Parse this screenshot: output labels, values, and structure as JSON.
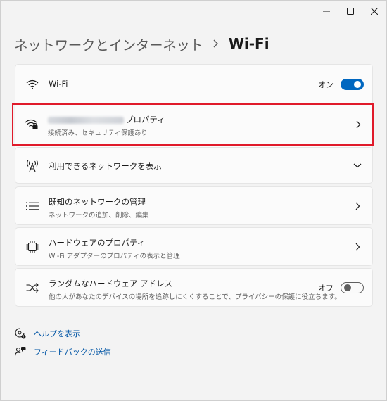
{
  "window": {
    "controls": [
      "minimize",
      "maximize",
      "close"
    ]
  },
  "breadcrumb": {
    "parent": "ネットワークとインターネット",
    "separator_icon": "chevron-right-icon",
    "current": "Wi-Fi"
  },
  "wifi_toggle_row": {
    "icon": "wifi-icon",
    "title": "Wi-Fi",
    "state_label": "オン",
    "enabled": true
  },
  "properties_row": {
    "icon": "wifi-secured-icon",
    "title_suffix": "プロパティ",
    "subtitle": "接続済み、セキュリティ保護あり",
    "name_blurred": true
  },
  "available_networks_row": {
    "icon": "antenna-icon",
    "title": "利用できるネットワークを表示"
  },
  "known_networks_row": {
    "icon": "list-icon",
    "title": "既知のネットワークの管理",
    "subtitle": "ネットワークの追加、削除、編集"
  },
  "hardware_row": {
    "icon": "chip-icon",
    "title": "ハードウェアのプロパティ",
    "subtitle": "Wi-Fi アダプターのプロパティの表示と管理"
  },
  "random_hw_row": {
    "icon": "shuffle-icon",
    "title": "ランダムなハードウェア アドレス",
    "subtitle": "他の人があなたのデバイスの場所を追跡しにくくすることで、プライバシーの保護に役立ちます。",
    "state_label": "オフ",
    "enabled": false
  },
  "links": [
    {
      "icon": "help-icon",
      "label": "ヘルプを表示"
    },
    {
      "icon": "feedback-icon",
      "label": "フィードバックの送信"
    }
  ],
  "colors": {
    "accent": "#0067c0",
    "highlight_border": "#e01a2a",
    "link": "#0055a5"
  }
}
